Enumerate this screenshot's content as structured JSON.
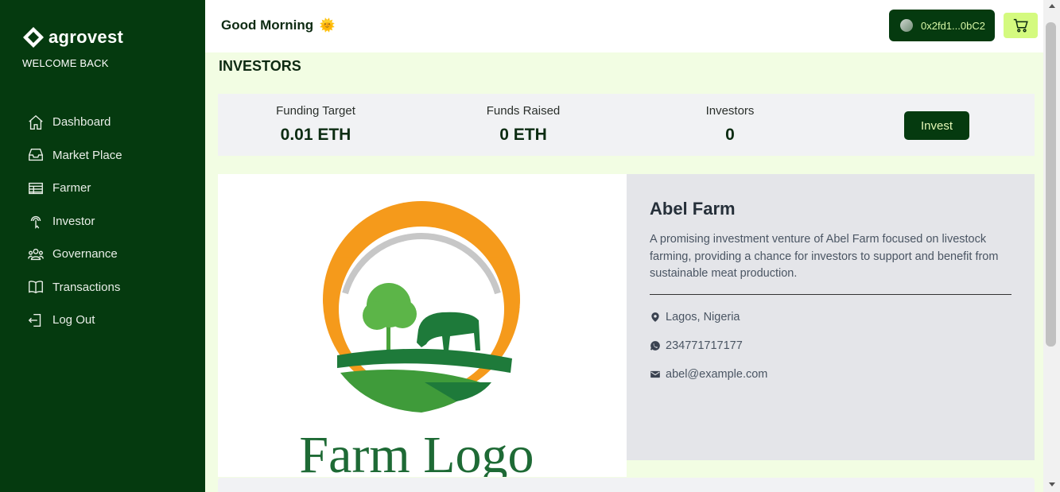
{
  "brand": {
    "name": "agrovest",
    "welcome": "WELCOME BACK"
  },
  "nav": [
    {
      "label": "Dashboard",
      "icon": "home-icon"
    },
    {
      "label": "Market Place",
      "icon": "inbox-icon"
    },
    {
      "label": "Farmer",
      "icon": "table-icon"
    },
    {
      "label": "Investor",
      "icon": "pointer-icon"
    },
    {
      "label": "Governance",
      "icon": "users-icon"
    },
    {
      "label": "Transactions",
      "icon": "book-icon"
    },
    {
      "label": "Log Out",
      "icon": "logout-icon"
    }
  ],
  "header": {
    "greeting": "Good Morning",
    "greeting_emoji": "🌞",
    "wallet_address": "0x2fd1...0bC2"
  },
  "page": {
    "title": "INVESTORS"
  },
  "stats": [
    {
      "label": "Funding Target",
      "value": "0.01 ETH"
    },
    {
      "label": "Funds Raised",
      "value": "0 ETH"
    },
    {
      "label": "Investors",
      "value": "0"
    }
  ],
  "invest_label": "Invest",
  "farm": {
    "name": "Abel Farm",
    "description": "A promising investment venture of Abel Farm focused on livestock farming, providing a chance for investors to support and benefit from sustainable meat production.",
    "location": "Lagos, Nigeria",
    "phone": "234771717177",
    "email": "abel@example.com",
    "logo_text": "Farm Logo"
  },
  "colors": {
    "sidebar": "#053a0f",
    "accent": "#d4fa7f",
    "page_bg": "#f2fde3"
  }
}
